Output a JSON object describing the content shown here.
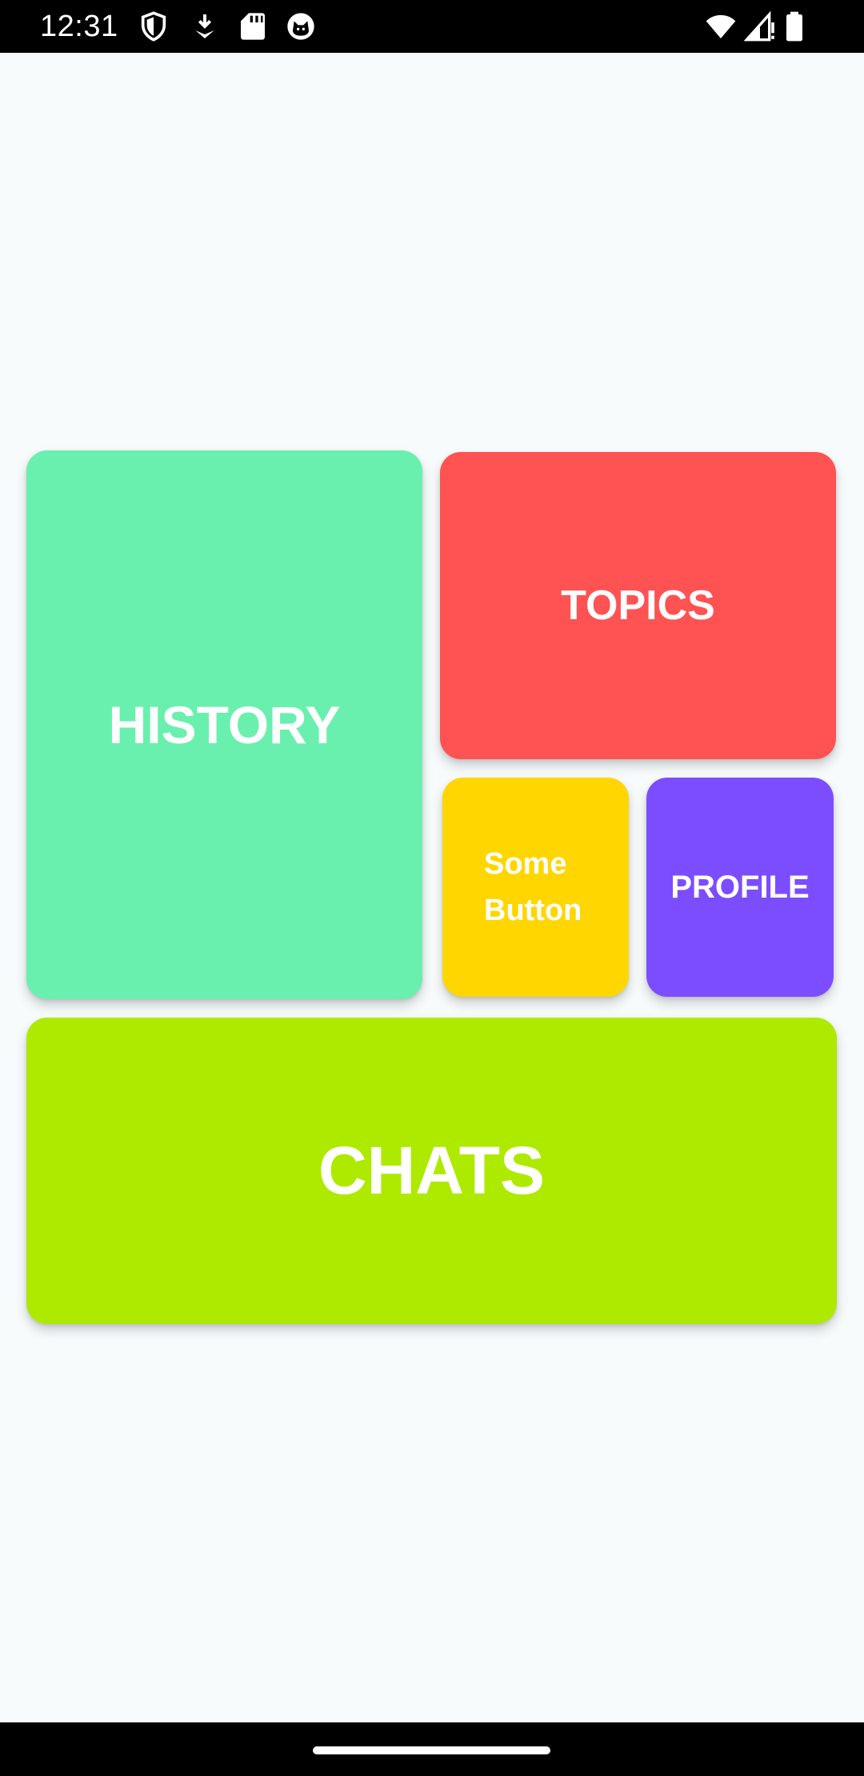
{
  "status_bar": {
    "time": "12:31",
    "left_icons": [
      "shield-icon",
      "download-icon",
      "sd-card-icon",
      "cat-icon"
    ],
    "right_icons": [
      "wifi-icon",
      "signal-icon",
      "battery-icon"
    ]
  },
  "tiles": {
    "history": {
      "label": "HISTORY",
      "color": "#69F0AE"
    },
    "topics": {
      "label": "TOPICS",
      "color": "#FF5252"
    },
    "some_button": {
      "label_line1": "Some",
      "label_line2": "Button",
      "color": "#FFD600"
    },
    "profile": {
      "label": "PROFILE",
      "color": "#7C4DFF"
    },
    "chats": {
      "label": "CHATS",
      "color": "#AEEA00"
    }
  }
}
